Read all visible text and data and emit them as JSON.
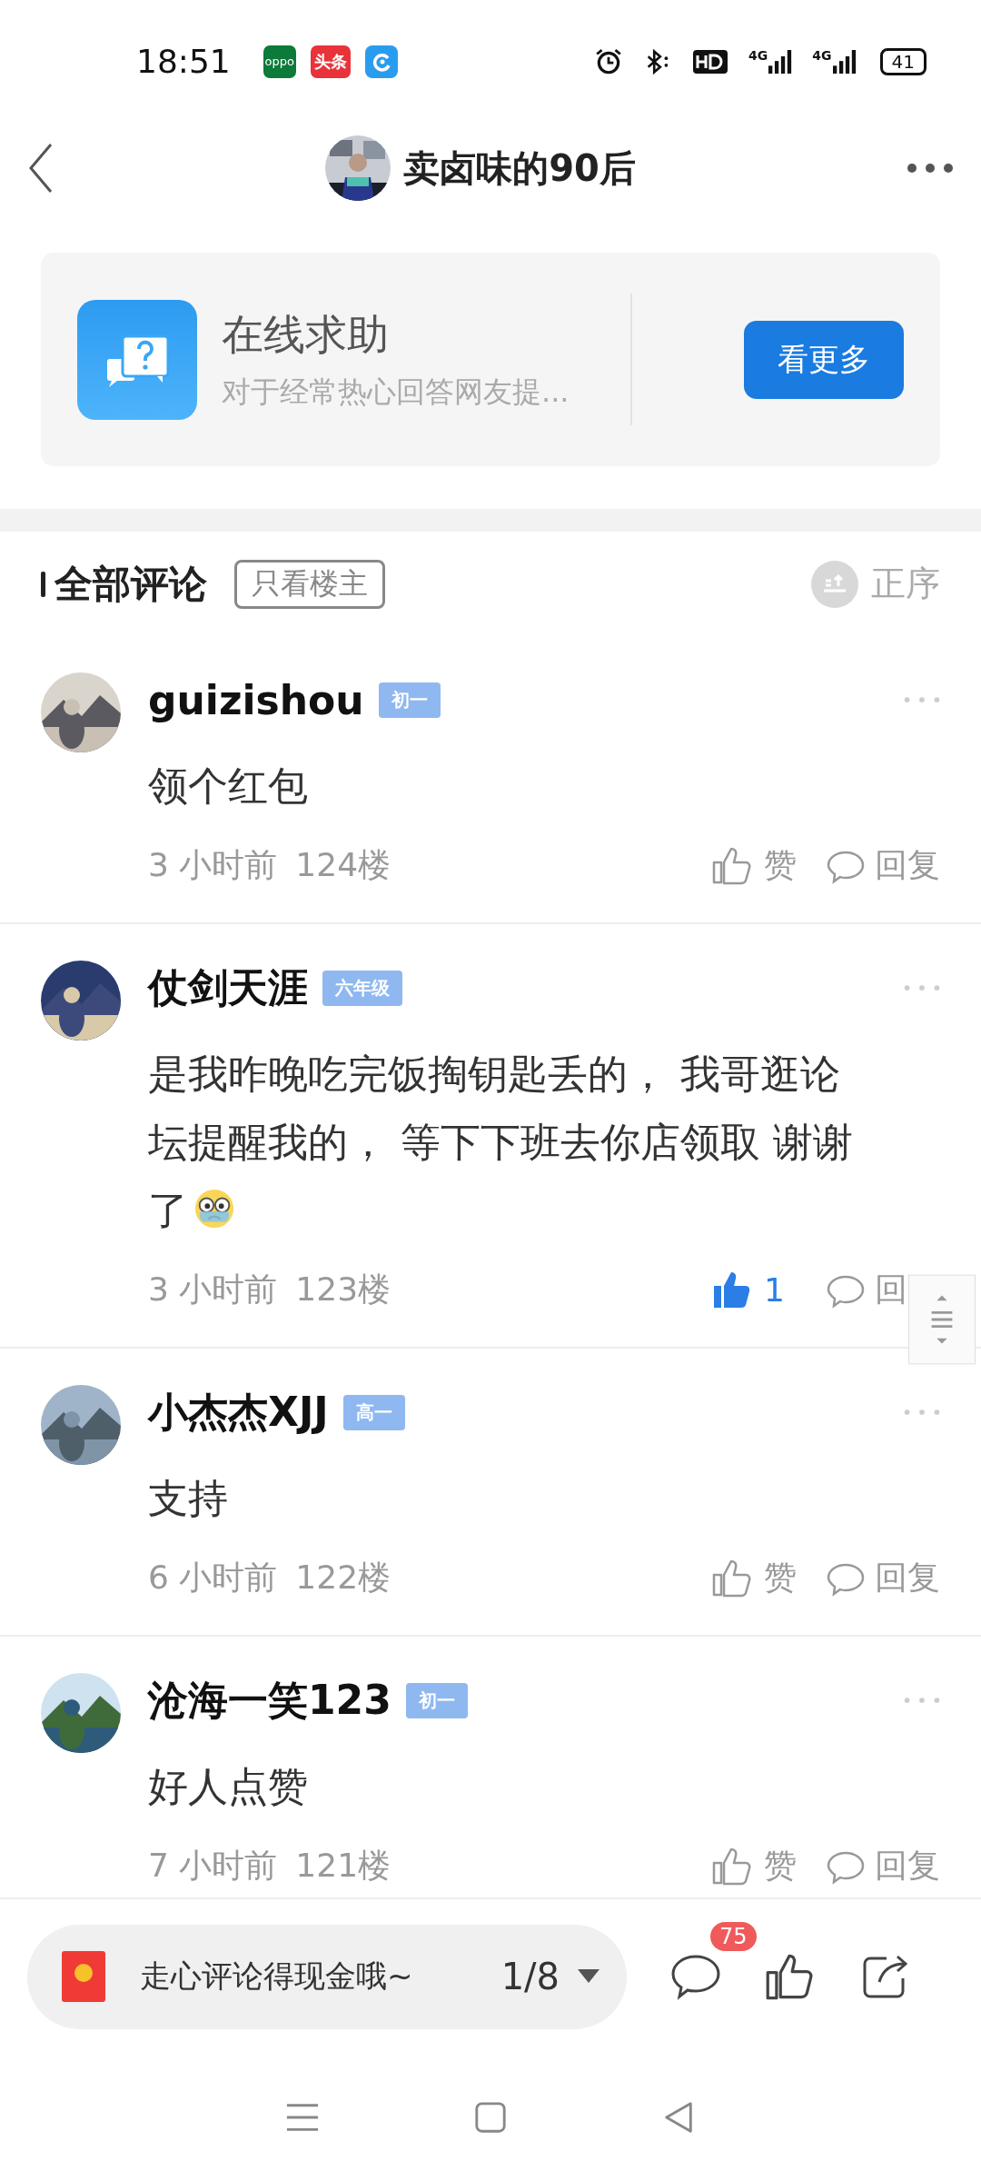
{
  "status_bar": {
    "time": "18:51",
    "app_icons": [
      {
        "kind": "oppo",
        "label": "oppo"
      },
      {
        "kind": "toutiao",
        "label": "头条"
      },
      {
        "kind": "browser"
      }
    ],
    "network": [
      "4G",
      "4G"
    ],
    "battery": "41"
  },
  "header": {
    "title": "卖卤味的90后"
  },
  "help_card": {
    "title": "在线求助",
    "subtitle": "对于经常热心回答网友提...",
    "button": "看更多"
  },
  "comments_header": {
    "title": "全部评论",
    "filter": {
      "label": "只看楼主",
      "selected": false
    },
    "sort": "正序"
  },
  "comments": [
    {
      "name": "guizishou",
      "level": "初一",
      "text": "领个红包",
      "emoji": false,
      "time": "3 小时前",
      "floor": "124楼",
      "like": {
        "label": "赞",
        "selected": false
      },
      "reply": "回复"
    },
    {
      "name": "仗剑天涯",
      "level": "六年级",
      "text": "是我昨晚吃完饭掏钥匙丢的， 我哥逛论坛提醒我的， 等下下班去你店领取  谢谢了",
      "emoji": true,
      "time": "3 小时前",
      "floor": "123楼",
      "like": {
        "label": "1",
        "selected": true
      },
      "reply": "回"
    },
    {
      "name": "小杰杰XJJ",
      "level": "高一",
      "text": "支持",
      "emoji": false,
      "time": "6 小时前",
      "floor": "122楼",
      "like": {
        "label": "赞",
        "selected": false
      },
      "reply": "回复"
    },
    {
      "name": "沧海一笑123",
      "level": "初一",
      "text": "好人点赞",
      "emoji": false,
      "time": "7 小时前",
      "floor": "121楼",
      "like": {
        "label": "赞",
        "selected": false
      },
      "reply": "回复"
    }
  ],
  "composer": {
    "prompt": "走心评论得现金哦~",
    "page": "1/8"
  },
  "actions": {
    "comment_count": "75"
  }
}
